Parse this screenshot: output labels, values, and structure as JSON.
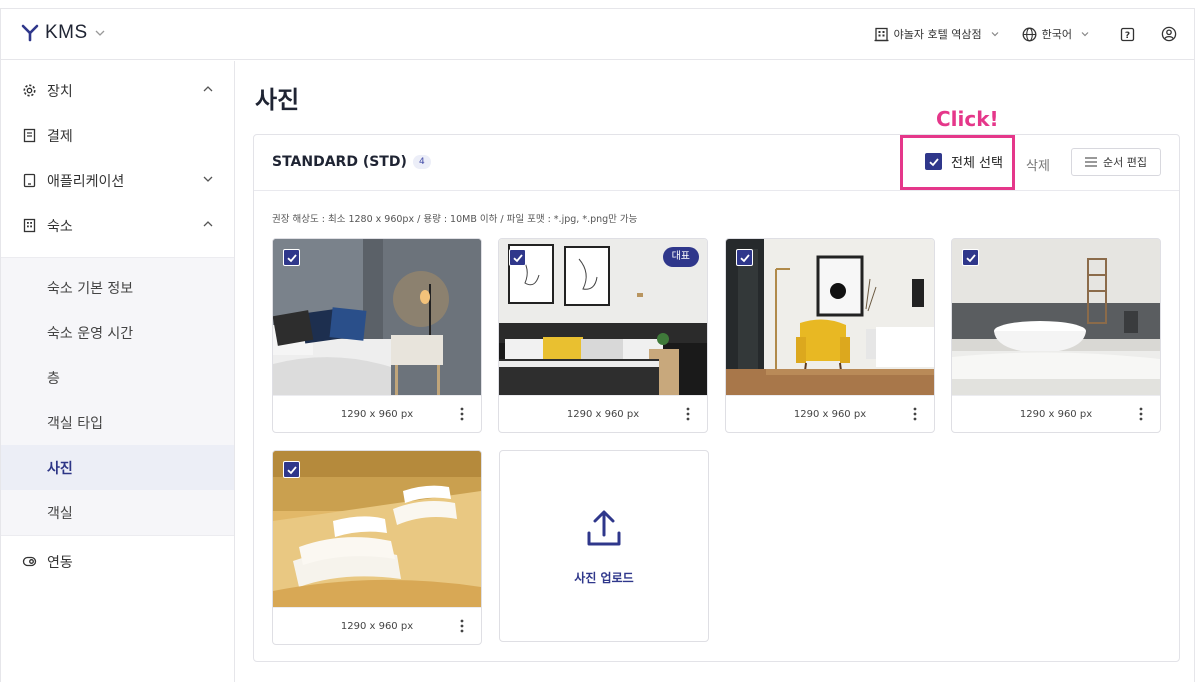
{
  "header": {
    "app_name": "KMS",
    "property": "야놀자 호텔 역삼점",
    "language": "한국어",
    "icons": [
      "kms-logo-icon",
      "chevron-down-icon",
      "building-icon",
      "globe-icon",
      "help-icon",
      "user-icon"
    ]
  },
  "sidebar": {
    "items": [
      {
        "label": "장치",
        "icon": "gear-icon",
        "caret": "up"
      },
      {
        "label": "결제",
        "icon": "receipt-icon"
      },
      {
        "label": "애플리케이션",
        "icon": "tablet-icon",
        "caret": "down"
      },
      {
        "label": "숙소",
        "icon": "building-icon",
        "caret": "up"
      },
      {
        "label": "연동",
        "icon": "link-icon"
      }
    ],
    "sub_items": [
      "숙소 기본 정보",
      "숙소 운영 시간",
      "층",
      "객실 타입",
      "사진",
      "객실"
    ],
    "active_sub_item": "사진"
  },
  "main": {
    "page_title": "사진",
    "card": {
      "title": "STANDARD (STD)",
      "count": "4",
      "select_all_label": "전체 선택",
      "select_all_checked": true,
      "delete_label": "삭제",
      "order_edit_label": "순서 편집",
      "hint": "권장 해상도 : 최소 1280 x 960px  / 용량 : 10MB 이하 / 파일 포맷 : *.jpg, *.png만 가능"
    },
    "annotation": {
      "label": "Click!",
      "color": "#e5378a"
    },
    "photos": [
      {
        "size": "1290 x 960 px",
        "checked": true,
        "representative": false
      },
      {
        "size": "1290 x 960 px",
        "checked": true,
        "representative": true
      },
      {
        "size": "1290 x 960 px",
        "checked": true,
        "representative": false
      },
      {
        "size": "1290 x 960 px",
        "checked": true,
        "representative": false
      },
      {
        "size": "1290 x 960 px",
        "checked": true,
        "representative": false
      }
    ],
    "representative_label": "대표",
    "upload_label": "사진 업로드"
  },
  "colors": {
    "brand": "#2f378b",
    "accent_pink": "#e5378a",
    "border": "#e3e3e8"
  }
}
